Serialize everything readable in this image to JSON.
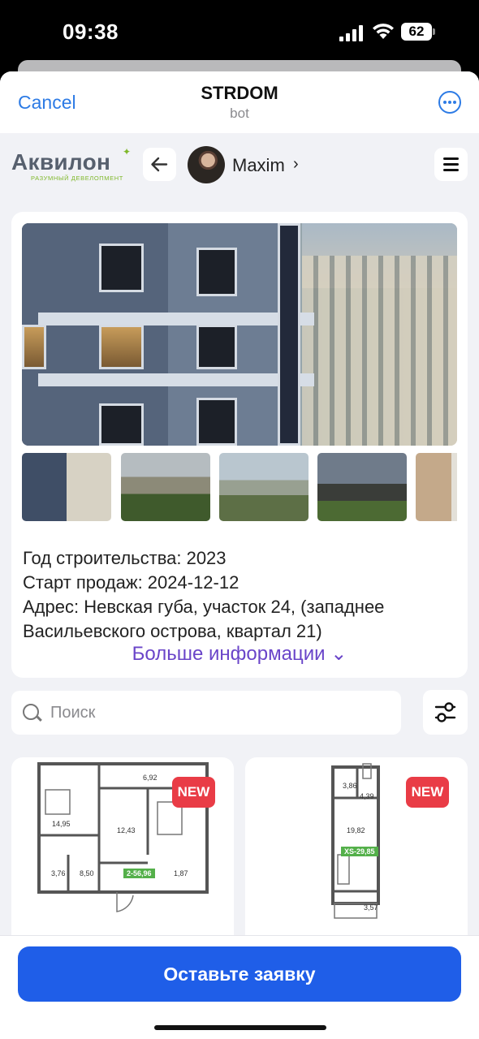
{
  "status_bar": {
    "time": "09:38",
    "battery": "62"
  },
  "header": {
    "cancel_label": "Cancel",
    "title": "STRDOM",
    "subtitle": "bot"
  },
  "brand": {
    "name": "Аквилон",
    "tagline": "РАЗУМНЫЙ ДЕВЕЛОПМЕНТ"
  },
  "user": {
    "name": "Maxim",
    "chevron": "›"
  },
  "project": {
    "info": [
      "Год строительства: 2023",
      "Старт продаж: 2024-12-12",
      "Адрес: Невская губа, участок 24, (западнее",
      "Васильевского острова, квартал 21)"
    ],
    "more_info_label": "Больше информации ⌄"
  },
  "search": {
    "placeholder": "Поиск"
  },
  "plans": [
    {
      "badge": "NEW",
      "tag": "2-56,96",
      "room_areas": [
        "14,95",
        "6,92",
        "12,43",
        "3,76",
        "8,50",
        "1,87"
      ]
    },
    {
      "badge": "NEW",
      "tag": "XS-29,85",
      "room_areas": [
        "3,86",
        "4,39",
        "19,82",
        "3,57"
      ]
    }
  ],
  "cta": {
    "label": "Оставьте заявку"
  },
  "colors": {
    "accent": "#2d7be5",
    "cta": "#1f5ee8",
    "badge": "#e93c46",
    "more_info": "#6a45c9",
    "brand_green": "#7fb82a"
  }
}
